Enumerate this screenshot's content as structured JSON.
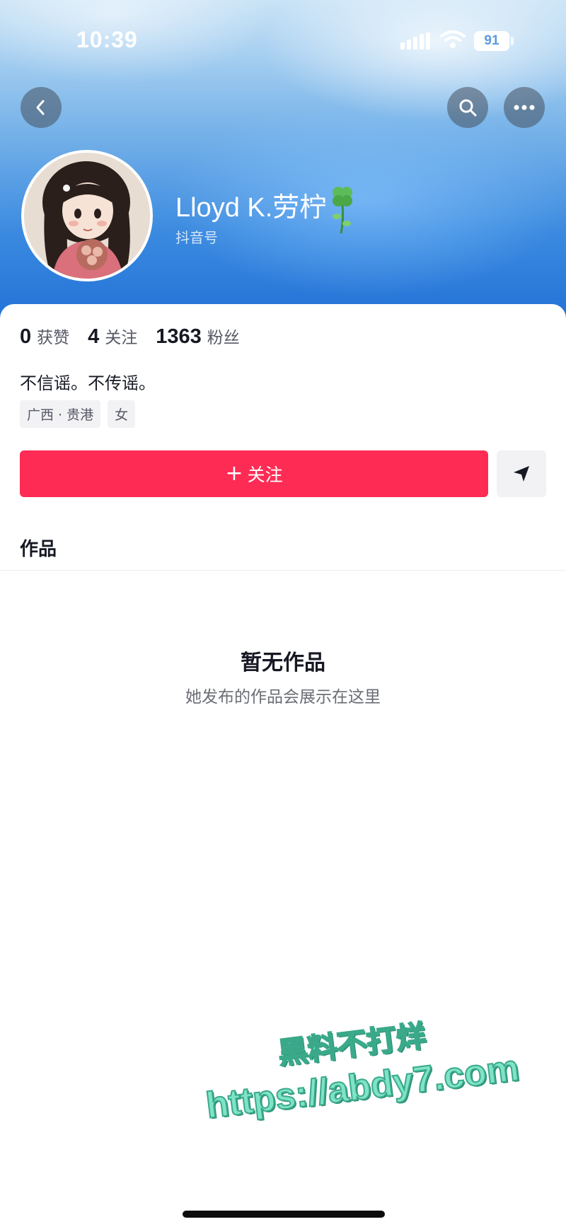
{
  "status_bar": {
    "time": "10:39",
    "battery": "91"
  },
  "profile": {
    "name": "Lloyd K.劳柠",
    "id_label": "抖音号",
    "stats": [
      {
        "value": "0",
        "label": "获赞"
      },
      {
        "value": "4",
        "label": "关注"
      },
      {
        "value": "1363",
        "label": "粉丝"
      }
    ],
    "bio": "不信谣。不传谣。",
    "tags": [
      "广西 · 贵港",
      "女"
    ]
  },
  "actions": {
    "follow_plus": "+",
    "follow_label": "关注"
  },
  "tabs": {
    "works": "作品"
  },
  "empty_state": {
    "title": "暂无作品",
    "subtitle": "她发布的作品会展示在这里"
  },
  "watermark": {
    "line1": "黑料不打烊",
    "line2": "https://abdy7.com"
  },
  "colors": {
    "accent": "#fe2c55",
    "header": "#3b8ae0"
  },
  "icons": [
    "back-icon",
    "search-icon",
    "more-icon",
    "clover-icon",
    "send-icon",
    "signal-icon",
    "wifi-icon"
  ]
}
